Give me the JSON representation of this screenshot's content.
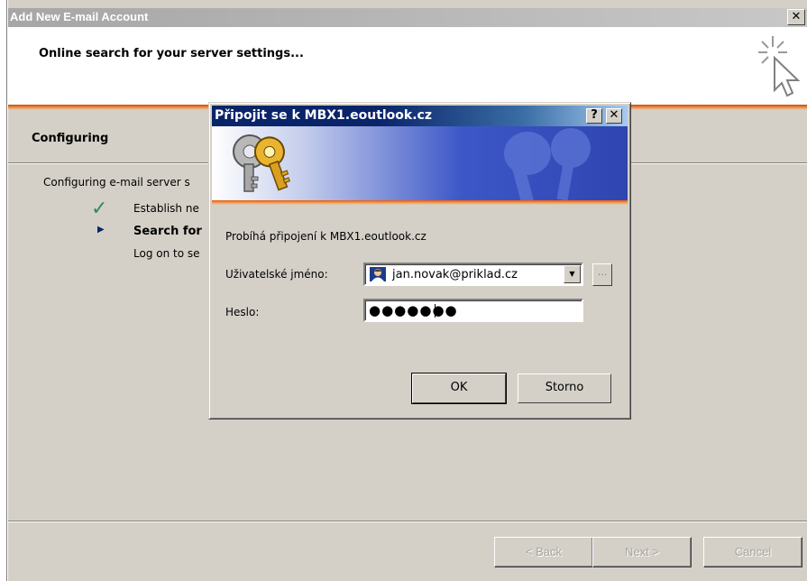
{
  "wizard": {
    "title": "Add New E-mail Account",
    "close_glyph": "✕",
    "heading": "Online search for your server settings...",
    "section_title": "Configuring",
    "config_text": "Configuring e-mail server s",
    "steps": [
      {
        "icon": "check-icon",
        "glyph": "✓",
        "color": "#2e8b57",
        "text": "Establish ne",
        "bold": false
      },
      {
        "icon": "arrow-right-icon",
        "glyph": "▶",
        "color": "#0a246a",
        "text": "Search for",
        "bold": true
      },
      {
        "icon": "",
        "glyph": "",
        "color": "",
        "text": "Log on to se",
        "bold": false
      }
    ],
    "buttons": {
      "back": "< Back",
      "next": "Next >",
      "cancel": "Cancel"
    }
  },
  "dialog": {
    "title": "Připojit se k MBX1.eoutlook.cz",
    "help_glyph": "?",
    "close_glyph": "✕",
    "status": "Probíhá připojení k MBX1.eoutlook.cz",
    "username_label": "Uživatelské jméno:",
    "username_value": "jan.novak@priklad.cz",
    "browse_label": "...",
    "password_label": "Heslo:",
    "password_mask": "●●●●●●●",
    "ok_label": "OK",
    "cancel_label": "Storno"
  },
  "colors": {
    "dialog_titlebar": "#0a246a",
    "banner_blue": "#3d57c8",
    "accent_orange": "#f28c3a"
  }
}
